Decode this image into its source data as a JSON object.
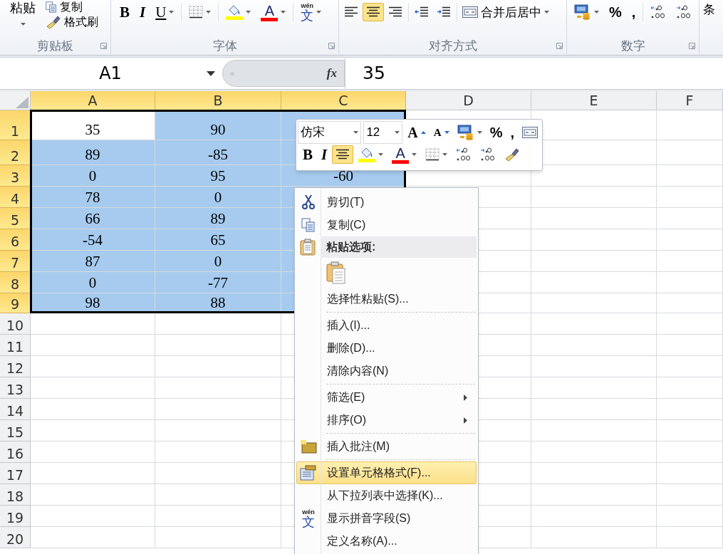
{
  "ribbon": {
    "clipboard": {
      "paste": "粘贴",
      "copy": "复制",
      "format_painter": "格式刷",
      "label": "剪贴板"
    },
    "font": {
      "label": "字体",
      "buttons": [
        {
          "kind": "bold",
          "text": "B"
        },
        {
          "kind": "italic",
          "text": "I"
        },
        {
          "kind": "underline",
          "text": "U"
        },
        {
          "kind": "borders"
        },
        {
          "kind": "fill-color"
        },
        {
          "kind": "font-color",
          "text": "A"
        },
        {
          "kind": "phonetic",
          "text": "wén",
          "glyph": "文"
        }
      ]
    },
    "alignment": {
      "label": "对齐方式",
      "buttons": [
        {
          "kind": "align-left",
          "selected": false
        },
        {
          "kind": "align-center",
          "selected": true
        },
        {
          "kind": "align-right",
          "selected": false
        },
        {
          "kind": "indent-decrease",
          "selected": false
        },
        {
          "kind": "indent-increase",
          "selected": false
        }
      ],
      "merge": "合并后居中"
    },
    "number": {
      "label": "数字",
      "buttons": [
        {
          "kind": "accounting"
        },
        {
          "kind": "text",
          "text": "%"
        },
        {
          "kind": "text",
          "text": ","
        },
        {
          "kind": "decimal-increase"
        },
        {
          "kind": "decimal-decrease"
        }
      ]
    },
    "next_group": "条"
  },
  "formula_bar": {
    "name_box": "A1",
    "function_button": "fx",
    "value": "35"
  },
  "columns": [
    {
      "label": "A",
      "selected": true
    },
    {
      "label": "B",
      "selected": true
    },
    {
      "label": "C",
      "selected": true
    },
    {
      "label": "D",
      "selected": false
    },
    {
      "label": "E",
      "selected": false
    },
    {
      "label": "F",
      "selected": false
    }
  ],
  "rows": [
    {
      "number": "1",
      "selected": true,
      "cells": [
        {
          "value": "35",
          "active": true
        },
        {
          "value": "90",
          "active": false
        }
      ]
    },
    {
      "number": "2",
      "selected": true,
      "cells": [
        {
          "value": "89",
          "active": false
        },
        {
          "value": "-85",
          "active": false
        }
      ]
    },
    {
      "number": "3",
      "selected": true,
      "cells": [
        {
          "value": "0",
          "active": false
        },
        {
          "value": "95",
          "active": false
        },
        {
          "value": "-60",
          "active": false
        }
      ]
    },
    {
      "number": "4",
      "selected": true,
      "cells": [
        {
          "value": "78",
          "active": false
        },
        {
          "value": "0",
          "active": false
        }
      ]
    },
    {
      "number": "5",
      "selected": true,
      "cells": [
        {
          "value": "66",
          "active": false
        },
        {
          "value": "89",
          "active": false
        }
      ]
    },
    {
      "number": "6",
      "selected": true,
      "cells": [
        {
          "value": "-54",
          "active": false
        },
        {
          "value": "65",
          "active": false
        }
      ]
    },
    {
      "number": "7",
      "selected": true,
      "cells": [
        {
          "value": "87",
          "active": false
        },
        {
          "value": "0",
          "active": false
        }
      ]
    },
    {
      "number": "8",
      "selected": true,
      "cells": [
        {
          "value": "0",
          "active": false
        },
        {
          "value": "-77",
          "active": false
        }
      ]
    },
    {
      "number": "9",
      "selected": true,
      "cells": [
        {
          "value": "98",
          "active": false
        },
        {
          "value": "88",
          "active": false
        }
      ]
    },
    {
      "number": "10",
      "selected": false
    },
    {
      "number": "11",
      "selected": false
    },
    {
      "number": "12",
      "selected": false
    },
    {
      "number": "13",
      "selected": false
    },
    {
      "number": "14",
      "selected": false
    },
    {
      "number": "15",
      "selected": false
    },
    {
      "number": "16",
      "selected": false
    },
    {
      "number": "17",
      "selected": false
    },
    {
      "number": "18",
      "selected": false
    },
    {
      "number": "19",
      "selected": false
    },
    {
      "number": "20",
      "selected": false
    }
  ],
  "mini_toolbar": {
    "font": "仿宋",
    "size": "12",
    "row1": [
      {
        "kind": "grow-font",
        "text": "A"
      },
      {
        "kind": "shrink-font",
        "text": "A"
      },
      {
        "kind": "accounting"
      },
      {
        "kind": "text",
        "text": "%"
      },
      {
        "kind": "text",
        "text": ","
      },
      {
        "kind": "merge"
      }
    ],
    "row2": [
      {
        "kind": "bold",
        "text": "B",
        "selected": false
      },
      {
        "kind": "italic",
        "text": "I",
        "selected": false
      },
      {
        "kind": "align-center",
        "selected": true
      },
      {
        "kind": "fill-color",
        "selected": false
      },
      {
        "kind": "font-color",
        "text": "A",
        "selected": false
      },
      {
        "kind": "borders",
        "selected": false
      },
      {
        "kind": "decimal-increase",
        "selected": false
      },
      {
        "kind": "decimal-decrease",
        "selected": false
      },
      {
        "kind": "painter",
        "selected": false
      }
    ]
  },
  "context_menu": [
    {
      "kind": "item",
      "label": "剪切(T)",
      "submenu": false,
      "selected": false
    },
    {
      "kind": "item",
      "label": "复制(C)",
      "submenu": false,
      "selected": false
    },
    {
      "kind": "header",
      "label": "粘贴选项:"
    },
    {
      "kind": "paste-option"
    },
    {
      "kind": "item",
      "label": "选择性粘贴(S)...",
      "submenu": false,
      "selected": false
    },
    {
      "kind": "separator"
    },
    {
      "kind": "item",
      "label": "插入(I)...",
      "submenu": false,
      "selected": false
    },
    {
      "kind": "item",
      "label": "删除(D)...",
      "submenu": false,
      "selected": false
    },
    {
      "kind": "item",
      "label": "清除内容(N)",
      "submenu": false,
      "selected": false
    },
    {
      "kind": "separator"
    },
    {
      "kind": "item",
      "label": "筛选(E)",
      "submenu": true,
      "selected": false
    },
    {
      "kind": "item",
      "label": "排序(O)",
      "submenu": true,
      "selected": false
    },
    {
      "kind": "separator"
    },
    {
      "kind": "item",
      "label": "插入批注(M)",
      "submenu": false,
      "selected": false
    },
    {
      "kind": "separator"
    },
    {
      "kind": "item",
      "label": "设置单元格格式(F)...",
      "submenu": false,
      "selected": true
    },
    {
      "kind": "item",
      "label": "从下拉列表中选择(K)...",
      "submenu": false,
      "selected": false
    },
    {
      "kind": "item",
      "label": "显示拼音字段(S)",
      "icon_text": "wén",
      "icon_glyph": "文",
      "submenu": false,
      "selected": false
    },
    {
      "kind": "item",
      "label": "定义名称(A)...",
      "submenu": false,
      "selected": false
    }
  ]
}
